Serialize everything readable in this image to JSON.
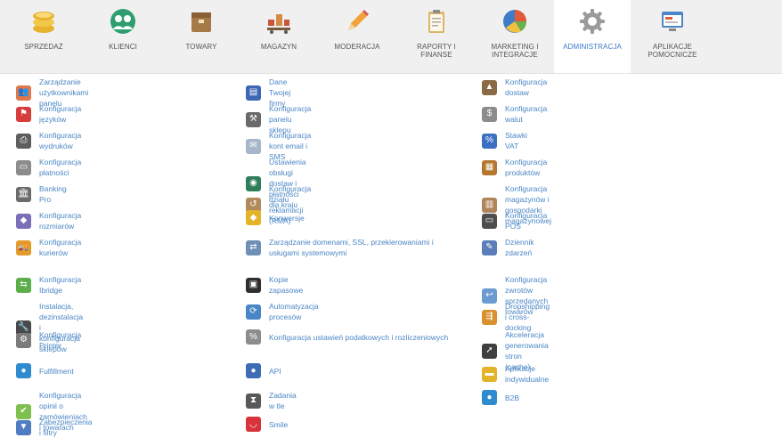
{
  "nav": [
    {
      "key": "sprzedaz",
      "label": "SPRZEDAŻ",
      "icon": "coins-icon",
      "color": "#e8b22e"
    },
    {
      "key": "klienci",
      "label": "KLIENCI",
      "icon": "clients-icon",
      "color": "#2f9e6e"
    },
    {
      "key": "towary",
      "label": "TOWARY",
      "icon": "box-icon",
      "color": "#a57a47"
    },
    {
      "key": "magazyn",
      "label": "MAGAZYN",
      "icon": "warehouse-icon",
      "color": "#c9553a"
    },
    {
      "key": "moderacja",
      "label": "MODERACJA",
      "icon": "pencil-icon",
      "color": "#f0a33a"
    },
    {
      "key": "raporty",
      "label": "RAPORTY I\nFINANSE",
      "icon": "clipboard-icon",
      "color": "#d8b76a"
    },
    {
      "key": "marketing",
      "label": "MARKETING I\nINTEGRACJE",
      "icon": "pie-chart-icon",
      "color": "#e15b3b"
    },
    {
      "key": "administracja",
      "label": "ADMINISTRACJA",
      "icon": "gear-icon",
      "color": "#9a9a9a",
      "active": true
    },
    {
      "key": "aplikacje",
      "label": "APLIKACJE\nPOMOCNICZE",
      "icon": "window-icon",
      "color": "#4d86c6"
    }
  ],
  "columns": [
    [
      {
        "label": "Zarządzanie użytkownikami panelu",
        "icon": "users-icon",
        "color": "#e1774b"
      },
      {
        "label": "Konfiguracja języków",
        "icon": "flag-icon",
        "color": "#d63e3e"
      },
      {
        "label": "Konfiguracja wydruków",
        "icon": "printer-icon",
        "color": "#5e5e5e"
      },
      {
        "label": "Konfiguracja płatności",
        "icon": "card-icon",
        "color": "#8c8c8c"
      },
      {
        "label": "Banking Pro",
        "icon": "bank-icon",
        "color": "#6b6b6b"
      },
      {
        "label": "Konfiguracja rozmiarów",
        "icon": "sizes-icon",
        "color": "#7a6fb8"
      },
      {
        "label": "Konfiguracja kurierów",
        "icon": "courier-icon",
        "color": "#e39b2c"
      },
      {
        "label": "Konfiguracja Ibridge",
        "icon": "ibridge-icon",
        "color": "#5cae4a"
      },
      {
        "label": "Instalacja, dezinstalacja i konfiguracja sklepów",
        "icon": "wrench-icon",
        "color": "#4a4a4a"
      },
      {
        "label": "Konfiguracja Printer",
        "icon": "printer-gear-icon",
        "color": "#7b7b7b"
      },
      {
        "label": "Fulfillment",
        "icon": "fulfillment-icon",
        "color": "#2e8bd0"
      },
      {
        "label": "Konfiguracja opinii o zamówieniach i towarach",
        "icon": "checkmark-icon",
        "color": "#7fbf4d"
      },
      {
        "label": "Zabezpieczenia i filtry",
        "icon": "shield-filter-icon",
        "color": "#4f7cc2"
      }
    ],
    [
      {
        "label": "Dane Twojej firmy",
        "icon": "company-icon",
        "color": "#3d67b5"
      },
      {
        "label": "Konfiguracja panelu sklepu",
        "icon": "hammer-icon",
        "color": "#6a6a6a"
      },
      {
        "label": "Konfiguracja kont email i SMS",
        "icon": "email-icon",
        "color": "#a7b6c9"
      },
      {
        "label": "Ustawienia obsługi dostaw i płatności dla kraju",
        "icon": "globe-icon",
        "color": "#2f7d5a"
      },
      {
        "label": "Konfiguracja działu reklamacji (RMA)",
        "icon": "rma-icon",
        "color": "#b08a5a"
      },
      {
        "label": "Konwersje",
        "icon": "conversion-icon",
        "color": "#e3b42a"
      },
      {
        "label": "Zarządzanie domenami, SSL, przekierowaniami i usługami systemowymi",
        "icon": "network-icon",
        "color": "#6f8fb5",
        "two": true
      },
      {
        "label": "Kopie zapasowe",
        "icon": "floppy-icon",
        "color": "#2f2f2f"
      },
      {
        "label": "Automatyzacja procesów",
        "icon": "automation-icon",
        "color": "#4a86c5"
      },
      {
        "label": "Konfiguracja ustawień podatkowych i rozliczeniowych",
        "icon": "tax-icon",
        "color": "#8c8c8c",
        "two": true
      },
      {
        "label": "API",
        "icon": "api-icon",
        "color": "#3f6db5"
      },
      {
        "label": "Zadania w tle",
        "icon": "background-tasks-icon",
        "color": "#595959"
      },
      {
        "label": "Smile",
        "icon": "smile-icon",
        "color": "#d8323a"
      }
    ],
    [
      {
        "label": "Konfiguracja dostaw",
        "icon": "delivery-icon",
        "color": "#8a6a45"
      },
      {
        "label": "Konfiguracja walut",
        "icon": "currency-icon",
        "color": "#8c8c8c"
      },
      {
        "label": "Stawki VAT",
        "icon": "vat-icon",
        "color": "#3d6fc2"
      },
      {
        "label": "Konfiguracja produktów",
        "icon": "products-icon",
        "color": "#b5772f"
      },
      {
        "label": "Konfiguracja magazynów i gospodarki magazynowej",
        "icon": "storage-icon",
        "color": "#b0845a"
      },
      {
        "label": "Konfiguracja POS",
        "icon": "pos-icon",
        "color": "#4e4e4e"
      },
      {
        "label": "Dziennik zdarzeń",
        "icon": "log-icon",
        "color": "#5a7fb8"
      },
      {
        "label": "Konfiguracja zwrotów sprzedanych towarów",
        "icon": "returns-icon",
        "color": "#6b9bd1"
      },
      {
        "label": "Dropshipping i cross-docking",
        "icon": "dropshipping-icon",
        "color": "#d9912f"
      },
      {
        "label": "Akceleracja generowania stron (cache)",
        "icon": "rocket-icon",
        "color": "#3f3f3f"
      },
      {
        "label": "Aplikacje indywidualne",
        "icon": "custom-apps-icon",
        "color": "#e3b42a"
      },
      {
        "label": "B2B",
        "icon": "b2b-icon",
        "color": "#2e8bd0"
      }
    ]
  ]
}
